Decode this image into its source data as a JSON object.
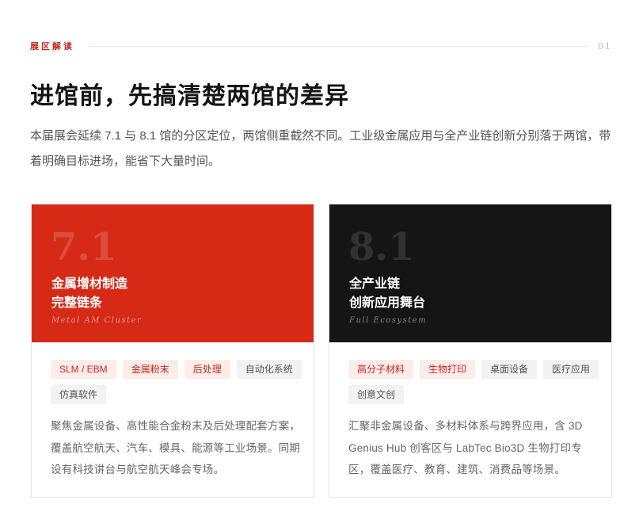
{
  "section": {
    "label": "展区解读",
    "number": "01"
  },
  "title": "进馆前，先搞清楚两馆的差异",
  "intro": "本届展会延续 7.1 与 8.1 馆的分区定位，两馆侧重截然不同。工业级金属应用与全产业链创新分别落于两馆，带着明确目标进场，能省下大量时间。",
  "halls": [
    {
      "number": "7.1",
      "title_line1": "金属增材制造",
      "title_line2": "完整链条",
      "subtitle_en": "Metal AM Cluster",
      "accent_color": "#d62a17",
      "tags": [
        {
          "label": "SLM / EBM",
          "style": "hot"
        },
        {
          "label": "金属粉末",
          "style": "hot"
        },
        {
          "label": "后处理",
          "style": "hot"
        },
        {
          "label": "自动化系统",
          "style": "plain"
        },
        {
          "label": "仿真软件",
          "style": "plain"
        }
      ],
      "description": "聚焦金属设备、高性能合金粉末及后处理配套方案，覆盖航空航天、汽车、模具、能源等工业场景。同期设有科技讲台与航空航天峰会专场。"
    },
    {
      "number": "8.1",
      "title_line1": "全产业链",
      "title_line2": "创新应用舞台",
      "subtitle_en": "Full Ecosystem",
      "accent_color": "#151515",
      "tags": [
        {
          "label": "高分子材料",
          "style": "hot"
        },
        {
          "label": "生物打印",
          "style": "hot"
        },
        {
          "label": "桌面设备",
          "style": "plain"
        },
        {
          "label": "医疗应用",
          "style": "plain"
        },
        {
          "label": "创意文创",
          "style": "plain"
        }
      ],
      "description": "汇聚非金属设备、多材料体系与跨界应用，含 3D Genius Hub 创客区与 LabTec Bio3D 生物打印专区，覆盖医疗、教育、建筑、消费品等场景。"
    }
  ]
}
